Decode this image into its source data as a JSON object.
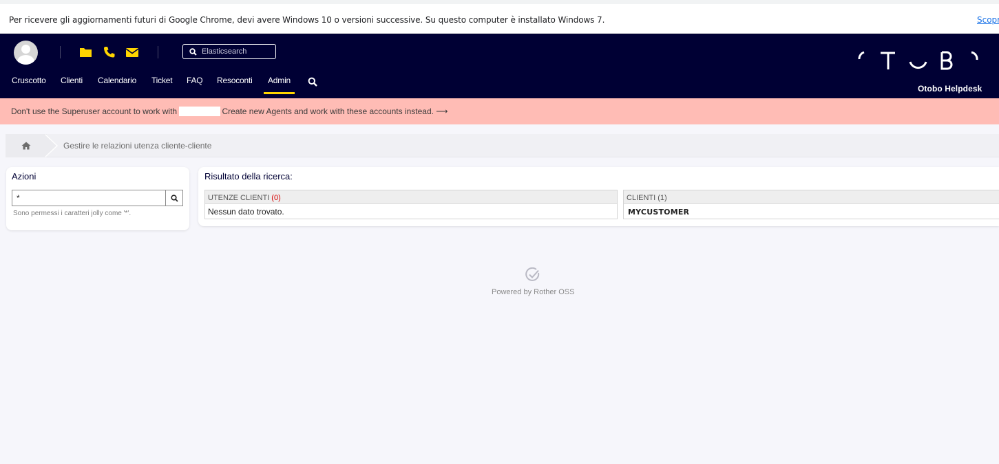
{
  "chrome_bar": {
    "message": "Per ricevere gli aggiornamenti futuri di Google Chrome, devi avere Windows 10 o versioni successive. Su questo computer è installato Windows 7.",
    "link": "Scopri"
  },
  "header": {
    "search": {
      "placeholder": "Elasticsearch"
    },
    "nav": {
      "items": [
        {
          "label": "Cruscotto"
        },
        {
          "label": "Clienti"
        },
        {
          "label": "Calendario"
        },
        {
          "label": "Ticket"
        },
        {
          "label": "FAQ"
        },
        {
          "label": "Resoconti"
        },
        {
          "label": "Admin",
          "active": true
        }
      ]
    },
    "brand": {
      "subtitle": "Otobo Helpdesk"
    },
    "accent_color": "#ffd500",
    "background_color": "#000034",
    "icons": [
      "user-avatar-icon",
      "folder-icon",
      "phone-icon",
      "envelope-icon",
      "search-icon"
    ]
  },
  "warning": {
    "text_before": "Don't use the Superuser account to work with",
    "text_after": "Create new Agents and work with these accounts instead. ⟶",
    "background_color": "#ffbcb5"
  },
  "breadcrumb": {
    "current": "Gestire le relazioni utenza cliente-cliente"
  },
  "actions": {
    "title": "Azioni",
    "search_value": "*",
    "hint": "Sono permessi i caratteri jolly come '*'."
  },
  "results": {
    "title": "Risultato della ricerca:",
    "customer_users": {
      "header": "UTENZE CLIENTI",
      "count": "(0)",
      "empty_text": "Nessun dato trovato."
    },
    "customers": {
      "header": "CLIENTI",
      "count": "(1)",
      "rows": [
        "MYCUSTOMER"
      ]
    }
  },
  "footer": {
    "powered_by": "Powered by Rother OSS"
  }
}
